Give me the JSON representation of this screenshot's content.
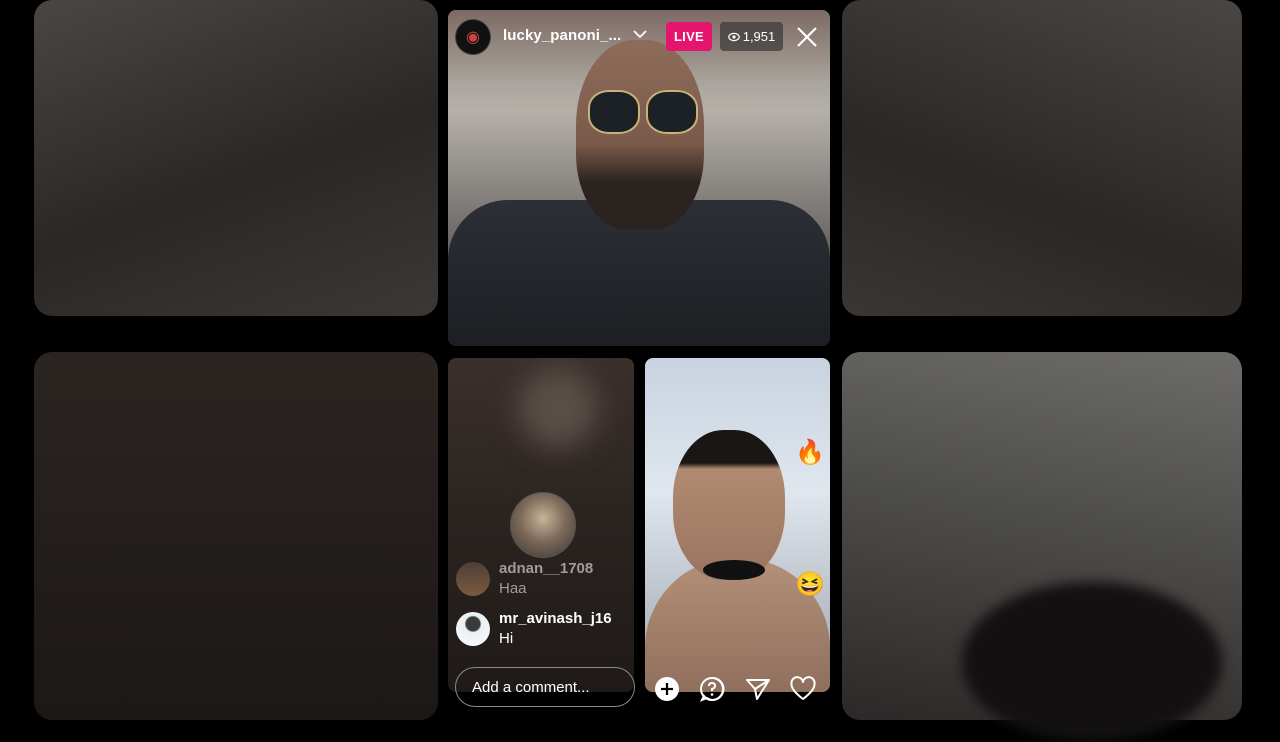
{
  "stream": {
    "host_username": "lucky_panoni_...",
    "live_label": "LIVE",
    "viewer_count": "1,951"
  },
  "comments": [
    {
      "username": "adnan__1708",
      "text": "Haa",
      "faded": true
    },
    {
      "username": "mr_avinash_j16",
      "text": "Hi",
      "faded": false
    }
  ],
  "composer": {
    "placeholder": "Add a comment..."
  },
  "icons": {
    "add": "plus-circle-icon",
    "question": "question-bubble-icon",
    "share": "paper-plane-icon",
    "like": "heart-icon",
    "close": "close-icon",
    "dropdown": "chevron-down-icon",
    "views": "eye-icon"
  },
  "colors": {
    "live_badge": "#e5146d",
    "viewer_badge": "#3c3c3c"
  }
}
